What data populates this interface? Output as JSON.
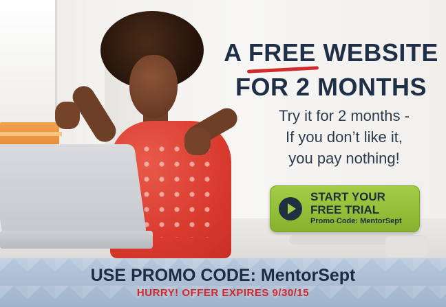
{
  "headline": {
    "line1_prefix": "A ",
    "line1_highlight": "FREE",
    "line1_suffix": " WEBSITE",
    "line2": "FOR 2 MONTHS"
  },
  "subtext": {
    "line1": "Try it for 2 months -",
    "line2": "If you don’t like it,",
    "line3": "you pay nothing!"
  },
  "cta": {
    "icon": "play-icon",
    "line1": "START YOUR",
    "line2": "FREE TRIAL",
    "promo": "Promo Code: MentorSept"
  },
  "banner": {
    "main": "USE PROMO CODE: MentorSept",
    "sub": "HURRY! OFFER EXPIRES 9/30/15"
  },
  "colors": {
    "headline": "#1f3046",
    "underline": "#d22b2b",
    "cta_green": "#a4cd46",
    "banner_bg": "#b7c8dc",
    "banner_sub": "#d4262a"
  }
}
